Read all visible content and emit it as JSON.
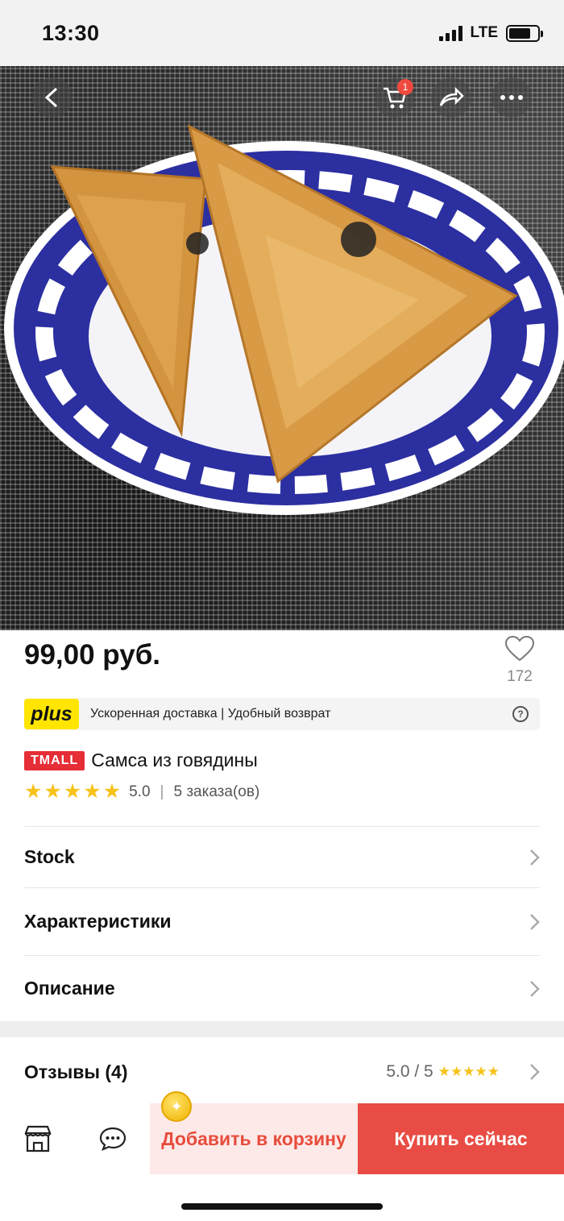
{
  "status": {
    "time": "13:30",
    "network": "LTE"
  },
  "topnav": {
    "cart_badge": "1"
  },
  "product": {
    "price": "99,00 руб.",
    "wishlist_count": "172",
    "plus": {
      "logo": "plus",
      "text": "Ускоренная доставка | Удобный возврат",
      "help": "?"
    },
    "badge": "TMALL",
    "title": "Самса из говядины",
    "rating": "5.0",
    "separator": "|",
    "orders": "5 заказа(ов)"
  },
  "sections": {
    "stock": "Stock",
    "specs": "Характеристики",
    "description": "Описание"
  },
  "reviews": {
    "label": "Отзывы (4)",
    "score": "5.0 / 5"
  },
  "actions": {
    "add_to_cart": "Добавить в корзину",
    "buy_now": "Купить сейчас"
  },
  "colors": {
    "accent": "#e84c44",
    "accent_light": "#fde9e8",
    "star": "#f7c21a",
    "plus_yellow": "#ffe500",
    "tmall_red": "#e62e37"
  },
  "icons": [
    "back-icon",
    "cart-icon",
    "share-icon",
    "more-icon",
    "heart-icon",
    "help-icon",
    "chevron-right-icon",
    "store-icon",
    "chat-icon",
    "coin-icon"
  ]
}
